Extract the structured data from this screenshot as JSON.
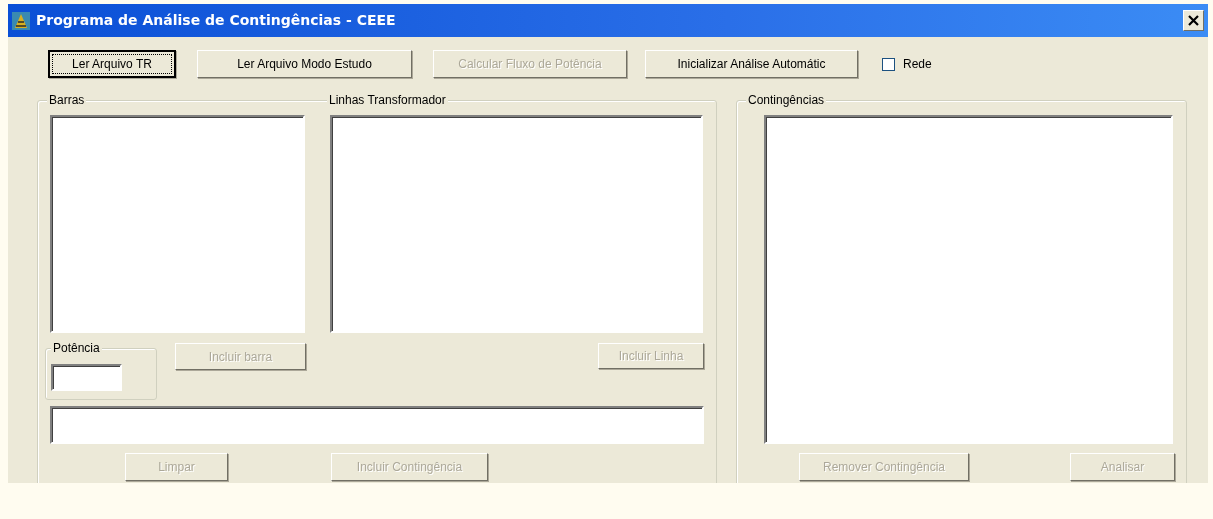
{
  "window": {
    "title": "Programa de Análise de Contingências - CEEE"
  },
  "toolbar": {
    "buttons": [
      {
        "label": "Ler Arquivo TR",
        "disabled": false,
        "focused": true
      },
      {
        "label": "Ler Arquivo Modo Estudo",
        "disabled": false,
        "focused": false
      },
      {
        "label": "Calcular Fluxo de Potência",
        "disabled": true,
        "focused": false
      },
      {
        "label": "Inicializar Análise Automátic",
        "disabled": false,
        "focused": false
      }
    ],
    "checkbox": {
      "label": "Rede",
      "checked": false
    }
  },
  "left_panel": {
    "barras_legend": "Barras",
    "linhas_legend": "Linhas Transformador",
    "potencia_legend": "Potência",
    "incluir_barra": {
      "label": "Incluir barra",
      "disabled": true
    },
    "incluir_linha": {
      "label": "Incluir Linha",
      "disabled": true
    },
    "limpar": {
      "label": "Limpar",
      "disabled": true
    },
    "incluir_contingencia": {
      "label": "Incluir Contingência",
      "disabled": true
    }
  },
  "right_panel": {
    "legend": "Contingências",
    "remover": {
      "label": "Remover Contingência",
      "disabled": true
    },
    "analisar": {
      "label": "Analisar",
      "disabled": true
    }
  }
}
